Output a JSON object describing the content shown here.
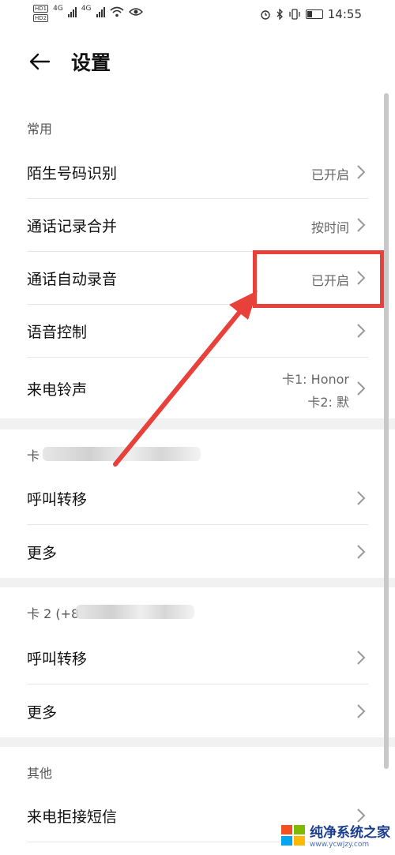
{
  "status_bar": {
    "hd1": "HD1",
    "hd2": "HD2",
    "net1": "4G",
    "net2": "4G",
    "time": "14:55"
  },
  "header": {
    "title": "设置"
  },
  "sections": {
    "common": {
      "title": "常用",
      "items": [
        {
          "label": "陌生号码识别",
          "value": "已开启"
        },
        {
          "label": "通话记录合并",
          "value": "按时间"
        },
        {
          "label": "通话自动录音",
          "value": "已开启"
        },
        {
          "label": "语音控制",
          "value": ""
        },
        {
          "label": "来电铃声",
          "value_line1": "卡1: Honor",
          "value_line2": "卡2: 默"
        }
      ]
    },
    "card1": {
      "title": "卡",
      "items": [
        {
          "label": "呼叫转移"
        },
        {
          "label": "更多"
        }
      ]
    },
    "card2": {
      "title": "卡 2 (+8",
      "items": [
        {
          "label": "呼叫转移"
        },
        {
          "label": "更多"
        }
      ]
    },
    "other": {
      "title": "其他",
      "items": [
        {
          "label": "来电拒接短信"
        }
      ]
    }
  },
  "watermark": {
    "name": "纯净系统之家",
    "url": "www.ycwjzy.com"
  },
  "colors": {
    "highlight": "#e8403a",
    "background": "#f1f1f1",
    "card": "#ffffff"
  }
}
